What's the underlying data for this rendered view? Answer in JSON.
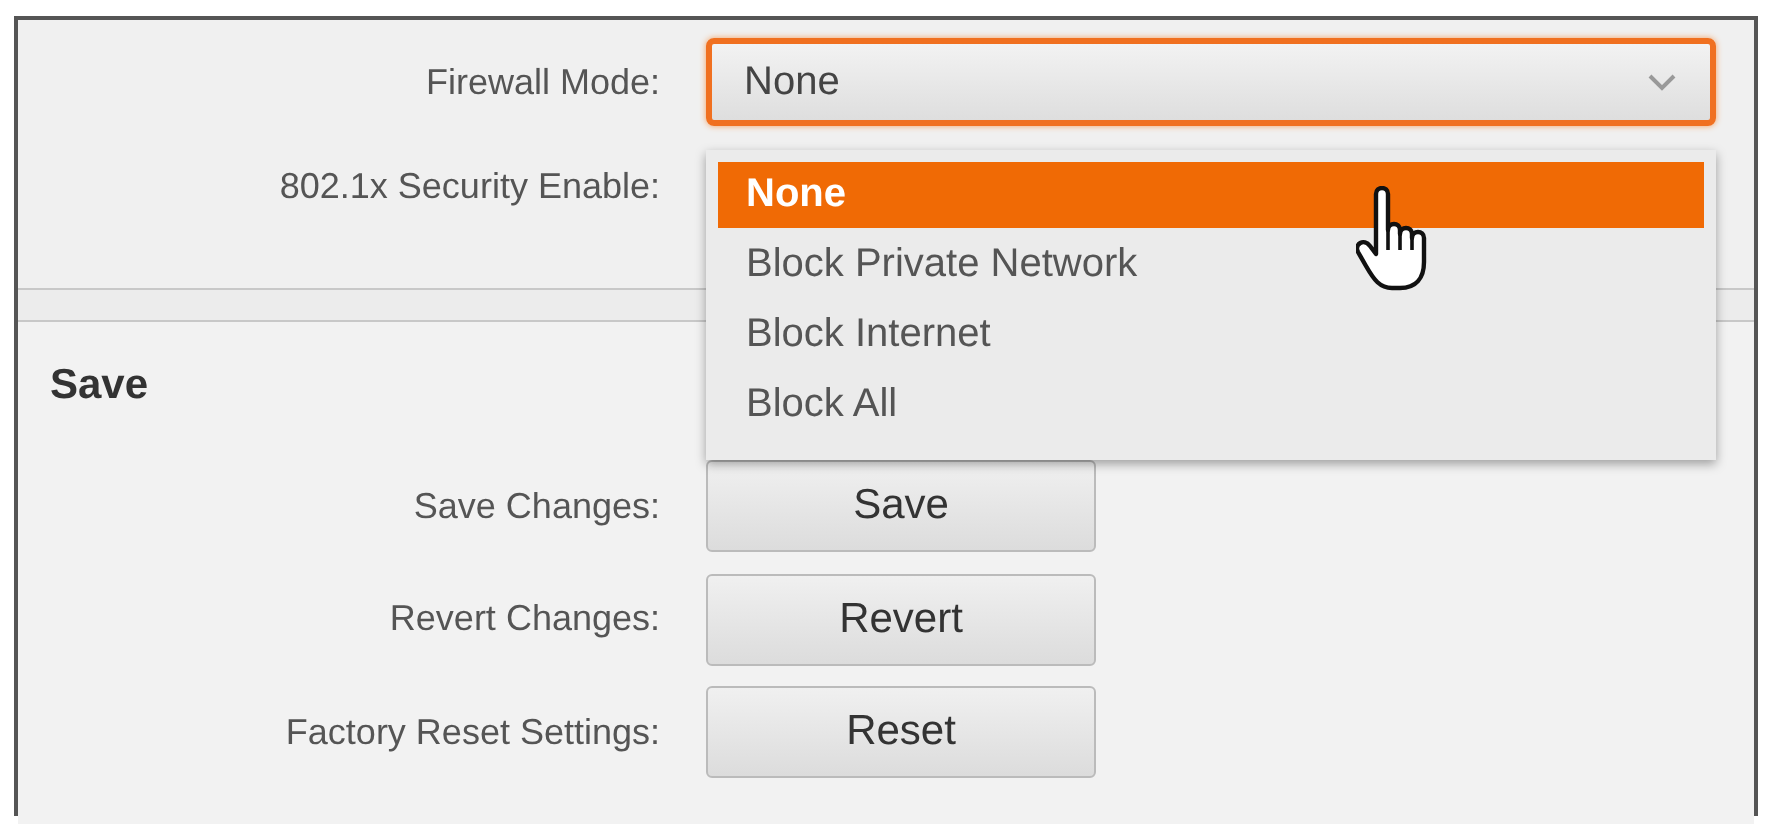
{
  "firewall": {
    "label": "Firewall Mode:",
    "value": "None",
    "expanded": true,
    "options": [
      {
        "label": "None",
        "selected": true
      },
      {
        "label": "Block Private Network",
        "selected": false
      },
      {
        "label": "Block Internet",
        "selected": false
      },
      {
        "label": "Block All",
        "selected": false
      }
    ]
  },
  "security": {
    "label": "802.1x Security Enable:"
  },
  "save_section": {
    "title": "Save",
    "rows": [
      {
        "label": "Save Changes:",
        "button": "Save"
      },
      {
        "label": "Revert Changes:",
        "button": "Revert"
      },
      {
        "label": "Factory Reset Settings:",
        "button": "Reset"
      }
    ]
  }
}
